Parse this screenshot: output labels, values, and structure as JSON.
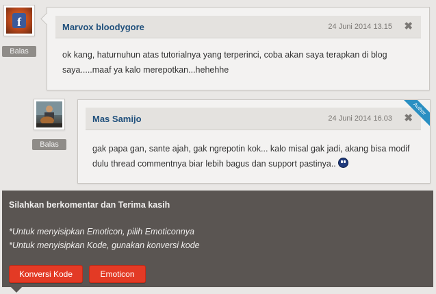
{
  "comments": [
    {
      "author": "Marvox bloodygore",
      "timestamp": "24 Juni 2014 13.15",
      "close": "✖",
      "reply_label": "Balas",
      "text": "ok kang, haturnuhun atas tutorialnya yang terperinci, coba akan saya terapkan di blog saya.....maaf ya kalo merepotkan...hehehhe"
    },
    {
      "author": "Mas Samijo",
      "timestamp": "24 Juni 2014 16.03",
      "close": "✖",
      "reply_label": "Balas",
      "badge": "Author",
      "text": "gak papa gan, sante ajah, gak ngrepotin kok... kalo misal gak jadi, akang bisa modif dulu thread commentnya biar lebih bagus dan support pastinya.."
    }
  ],
  "comment_form": {
    "title": "Silahkan berkomentar dan Terima kasih",
    "note_emoticon": "*Untuk menyisipkan Emoticon, pilih Emoticonnya",
    "note_code": "*Untuk menyisipkan Kode, gunakan konversi kode",
    "convert_button": "Konversi Kode",
    "emoticon_button": "Emoticon"
  },
  "icons": {
    "avatar_1": "facebook-icon",
    "avatar_2": "user-photo",
    "close": "close-icon",
    "smiley": "emoticon-icon"
  },
  "colors": {
    "accent_red": "#e33a25",
    "author_name": "#20507c",
    "ribbon": "#2a8fc2",
    "panel": "#5a5552"
  }
}
